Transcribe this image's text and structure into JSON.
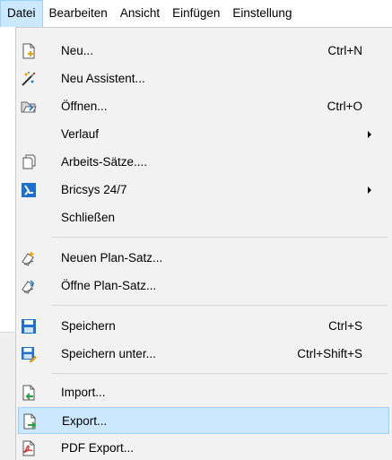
{
  "menubar": {
    "items": [
      "Datei",
      "Bearbeiten",
      "Ansicht",
      "Einfügen",
      "Einstellung"
    ]
  },
  "menu": {
    "items": [
      {
        "label": "Neu...",
        "shortcut": "Ctrl+N",
        "icon": "new-file-icon"
      },
      {
        "label": "Neu Assistent...",
        "shortcut": "",
        "icon": "wizard-icon"
      },
      {
        "label": "Öffnen...",
        "shortcut": "Ctrl+O",
        "icon": "open-folder-icon"
      },
      {
        "label": "Verlauf",
        "shortcut": "",
        "icon": "",
        "submenu": true
      },
      {
        "label": "Arbeits-Sätze....",
        "shortcut": "",
        "icon": "worksets-icon"
      },
      {
        "label": "Bricsys 24/7",
        "shortcut": "",
        "icon": "bricsys-icon",
        "submenu": true
      },
      {
        "label": "Schließen",
        "shortcut": "",
        "icon": ""
      },
      {
        "label": "Neuen Plan-Satz...",
        "shortcut": "",
        "icon": "new-sheetset-icon"
      },
      {
        "label": "Öffne Plan-Satz...",
        "shortcut": "",
        "icon": "open-sheetset-icon"
      },
      {
        "label": "Speichern",
        "shortcut": "Ctrl+S",
        "icon": "save-icon"
      },
      {
        "label": "Speichern unter...",
        "shortcut": "Ctrl+Shift+S",
        "icon": "save-as-icon"
      },
      {
        "label": "Import...",
        "shortcut": "",
        "icon": "import-icon"
      },
      {
        "label": "Export...",
        "shortcut": "",
        "icon": "export-icon"
      },
      {
        "label": "PDF Export...",
        "shortcut": "",
        "icon": "pdf-export-icon"
      }
    ]
  },
  "colors": {
    "highlight": "#cce8ff",
    "highlight_border": "#99d1ff",
    "menu_bg": "#f2f2f2"
  }
}
